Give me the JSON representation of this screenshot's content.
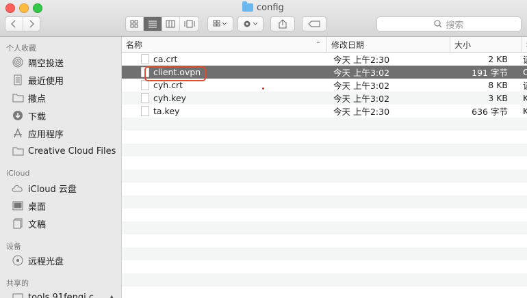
{
  "window": {
    "title": "config"
  },
  "toolbar": {
    "search_placeholder": "搜索"
  },
  "sidebar": {
    "sections": [
      {
        "heading": "个人收藏",
        "items": [
          {
            "label": "隔空投送",
            "icon": "airdrop-icon"
          },
          {
            "label": "最近使用",
            "icon": "recents-icon"
          },
          {
            "label": "撒点",
            "icon": "folder-icon"
          },
          {
            "label": "下载",
            "icon": "downloads-icon"
          },
          {
            "label": "应用程序",
            "icon": "applications-icon"
          },
          {
            "label": "Creative Cloud Files",
            "icon": "folder-icon"
          }
        ]
      },
      {
        "heading": "iCloud",
        "items": [
          {
            "label": "iCloud 云盘",
            "icon": "cloud-icon"
          },
          {
            "label": "桌面",
            "icon": "desktop-icon"
          },
          {
            "label": "文稿",
            "icon": "documents-icon"
          }
        ]
      },
      {
        "heading": "设备",
        "items": [
          {
            "label": "远程光盘",
            "icon": "disc-icon"
          }
        ]
      },
      {
        "heading": "共享的",
        "items": [
          {
            "label": "tools.91fengj.c...",
            "icon": "server-icon"
          }
        ]
      }
    ]
  },
  "columns": {
    "name": "名称",
    "modified": "修改日期",
    "size": "大小",
    "kind": "种"
  },
  "files": [
    {
      "name": "ca.crt",
      "modified": "今天 上午2:30",
      "size": "2 KB",
      "kind": "证"
    },
    {
      "name": "client.ovpn",
      "modified": "今天 上午3:02",
      "size": "191 字节",
      "kind": "O"
    },
    {
      "name": "cyh.crt",
      "modified": "今天 上午3:02",
      "size": "8 KB",
      "kind": "证"
    },
    {
      "name": "cyh.key",
      "modified": "今天 上午3:02",
      "size": "3 KB",
      "kind": "K"
    },
    {
      "name": "ta.key",
      "modified": "今天 上午2:30",
      "size": "636 字节",
      "kind": "K"
    }
  ],
  "selected_index": 1
}
